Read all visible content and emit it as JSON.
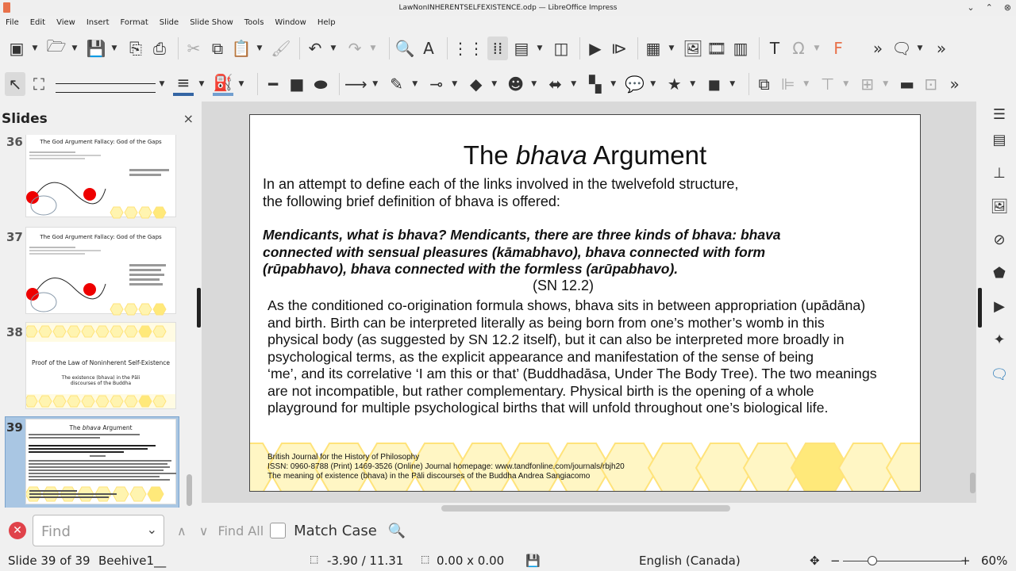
{
  "window": {
    "title": "LawNonINHERENTSELFEXISTENCE.odp — LibreOffice Impress"
  },
  "menu": [
    "File",
    "Edit",
    "View",
    "Insert",
    "Format",
    "Slide",
    "Slide Show",
    "Tools",
    "Window",
    "Help"
  ],
  "pane": {
    "title": "Slides",
    "close": "×"
  },
  "thumbs": [
    {
      "num": "36",
      "title": "The God Argument Fallacy: God of the Gaps"
    },
    {
      "num": "37",
      "title": "The God Argument Fallacy: God of the Gaps"
    },
    {
      "num": "38",
      "title": "Proof of the Law of Noninherent Self-Existence",
      "sub1": "The existence (bhava) in the Pāli",
      "sub2": "discourses of the Buddha"
    },
    {
      "num": "39",
      "title_pre": "The ",
      "title_em": "bhava",
      "title_post": " Argument"
    }
  ],
  "slide": {
    "title_pre": "The ",
    "title_em": "bhava",
    "title_post": " Argument",
    "intro1": "In an attempt to define each of the links involved in the twelvefold structure,",
    "intro2": "the following brief definition of bhava is offered:",
    "quote1": "Mendicants, what is bhava? Mendicants, there are three kinds of bhava: bhava",
    "quote2": "connected with sensual pleasures (kāmabhavo), bhava connected with form",
    "quote3": "(rūpabhavo), bhava connected with the formless (arūpabhavo).",
    "ref": "(SN 12.2)",
    "body": [
      "As the conditioned co-origination formula shows, bhava sits in between appropriation (upādāna)",
      "and birth. Birth can be interpreted literally as being born from one’s mother’s womb in this",
      "physical body (as suggested by SN 12.2 itself), but it can also be interpreted more broadly in",
      "psychological terms, as the explicit appearance and manifestation of the sense of being",
      "‘me’, and its correlative ‘I am this or that’ (Buddhadāsa, Under The Body Tree). The two meanings",
      "are not incompatible, but rather complementary. Physical birth is the opening of a whole",
      "playground for multiple psychological births that will unfold throughout one’s biological life."
    ],
    "footer": [
      "British Journal for the History of Philosophy",
      "ISSN: 0960-8788 (Print) 1469-3526 (Online) Journal homepage: www.tandfonline.com/journals/rbjh20",
      "The meaning of existence (bhava) in the Pāli discourses of the Buddha Andrea Sangiacomo"
    ]
  },
  "find": {
    "placeholder": "Find",
    "find_all": "Find All",
    "match_case": "Match Case"
  },
  "status": {
    "slide": "Slide 39 of 39",
    "layout": "Beehive1__",
    "position": "-3.90 / 11.31",
    "size": "0.00 x 0.00",
    "language": "English (Canada)",
    "zoom": "60%"
  },
  "colors": {
    "hex_fill": "#fff3b8",
    "hex_stroke": "#ffe37a",
    "hex_accent": "#ffe97a",
    "selected": "#a9c6e3"
  }
}
